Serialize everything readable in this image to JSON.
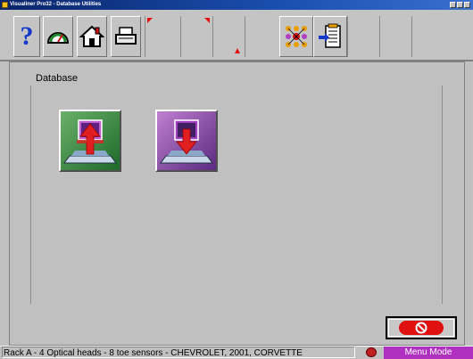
{
  "window": {
    "title": "Visualiner Pro32  -  Database Utilities"
  },
  "toolbar": {
    "buttons": [
      {
        "icon": "help-icon"
      },
      {
        "icon": "gauge-icon"
      },
      {
        "icon": "home-icon"
      },
      {
        "icon": "printer-icon"
      },
      {
        "icon": "empty-slot-icon"
      },
      {
        "icon": "empty-slot-icon"
      },
      {
        "icon": "empty-slot-icon"
      },
      {
        "icon": "empty-slot-icon"
      },
      {
        "icon": "network-icon"
      },
      {
        "icon": "notepad-icon"
      }
    ]
  },
  "main": {
    "heading": "Database",
    "tiles": [
      {
        "icon": "database-upload-icon",
        "color": "#2e8b3e"
      },
      {
        "icon": "database-download-icon",
        "color": "#8a4fb0"
      }
    ]
  },
  "cancel": {
    "icon": "cancel-icon",
    "color": "#e01010"
  },
  "status": {
    "text": "Rack A - 4 Optical heads - 8 toe sensors - CHEVROLET, 2001, CORVETTE",
    "mode": "Menu Mode",
    "mode_color": "#b030c0"
  }
}
